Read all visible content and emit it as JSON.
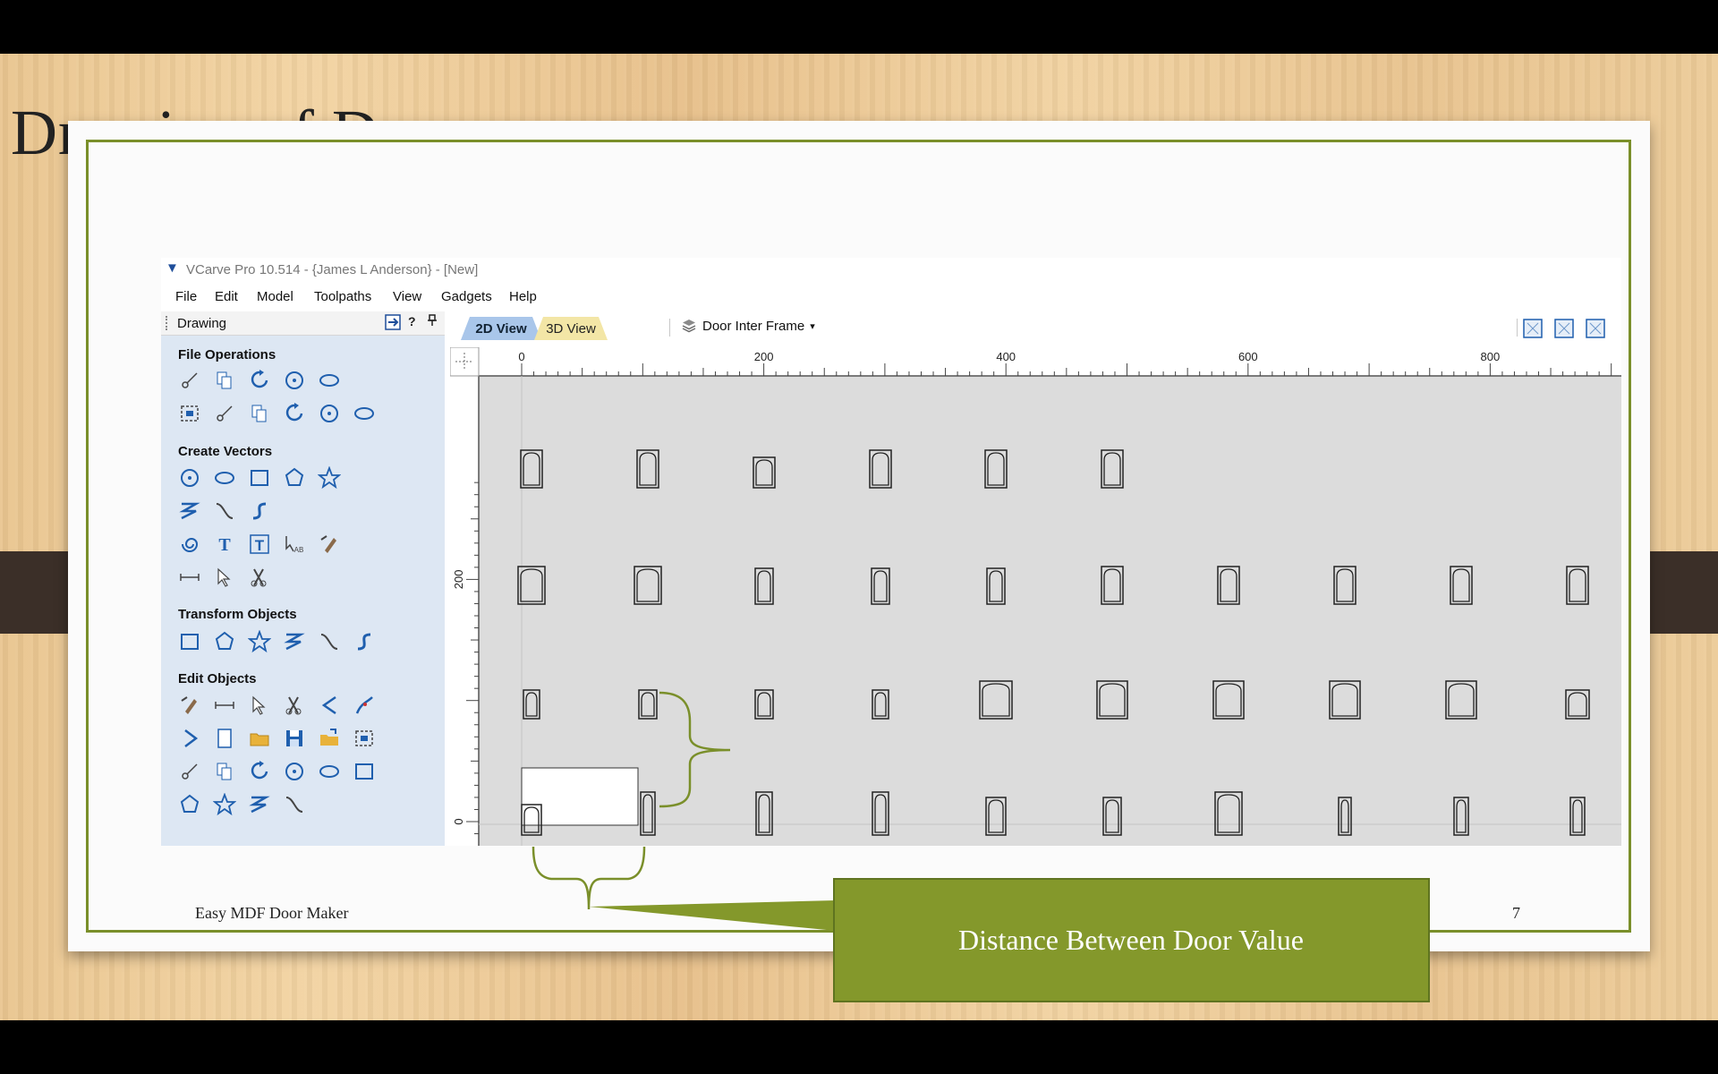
{
  "slide": {
    "title": "Drawing of Doors",
    "footer_left": "Easy MDF Door Maker",
    "page_number": "7",
    "callout_text": "Distance Between Door Value",
    "colors": {
      "frame": "#7a8f2a",
      "callout": "#84982b"
    }
  },
  "app": {
    "window_title": "VCarve Pro 10.514 - {James L Anderson} - [New]",
    "menu": [
      "File",
      "Edit",
      "Model",
      "Toolpaths",
      "View",
      "Gadgets",
      "Help"
    ],
    "panel": {
      "title": "Drawing",
      "buttons": {
        "help": "?",
        "pin": "⌂"
      },
      "sections": {
        "file_operations": "File Operations",
        "create_vectors": "Create Vectors",
        "transform_objects": "Transform Objects",
        "edit_objects": "Edit Objects"
      }
    },
    "tabs": {
      "view_2d": "2D View",
      "view_3d": "3D View"
    },
    "layer": {
      "name": "Door Inter Frame",
      "arrow": "▾"
    },
    "ruler": {
      "top_labels": [
        "0",
        "200",
        "400",
        "600",
        "800"
      ],
      "left_labels": [
        "200",
        "0"
      ]
    }
  },
  "icons": {
    "file_operations": [
      "new-file-icon",
      "open-folder-icon",
      "save-icon",
      "open-project-icon",
      "import-icon",
      "select-all-icon",
      "cut-icon",
      "copy-icon",
      "paste-icon",
      "undo-icon",
      "redo-icon"
    ],
    "create_vectors": [
      "circle-icon",
      "ellipse-icon",
      "rectangle-icon",
      "polygon-icon",
      "star-icon",
      "polyline-icon",
      "curve-icon",
      "spline-icon",
      "spiral-icon",
      "text-icon",
      "text-frame-icon",
      "text-on-curve-icon",
      "auto-layout-text-icon",
      "text-style-icon",
      "bitmap-trace-icon",
      "dimension-icon"
    ],
    "transform_objects": [
      "move-icon",
      "scale-icon",
      "align-icon",
      "mirror-icon",
      "distort-icon",
      "center-icon"
    ],
    "edit_objects": [
      "select-icon",
      "node-edit-icon",
      "transform-select-icon",
      "group-icon",
      "ungroup-icon",
      "measure-icon",
      "weld-icon",
      "subtract-icon",
      "intersect-icon",
      "trim-icon",
      "scissors-icon",
      "fillet-icon",
      "chamfer-icon",
      "angle-icon",
      "smooth-icon",
      "offset-icon",
      "image-icon",
      "crop-icon",
      "join-icon",
      "close-icon",
      "extend-icon",
      "arc-icon"
    ],
    "view_toolbar": [
      "zoom-extents-icon",
      "layout-icon",
      "grid-icon",
      "pan-icon",
      "zoom-icon",
      "zoom-in-icon",
      "zoom-out-icon",
      "snap-icon"
    ]
  },
  "doors": [
    {
      "row": "top",
      "positions": [
        0,
        1,
        2,
        3,
        4,
        5
      ]
    },
    {
      "row": "second",
      "positions": [
        0,
        1,
        2,
        3,
        4,
        5,
        6,
        7,
        8,
        9
      ]
    },
    {
      "row": "third",
      "positions": [
        0,
        1,
        2,
        3,
        4,
        5,
        6,
        7,
        8,
        9
      ]
    },
    {
      "row": "bottom",
      "positions": [
        0,
        1,
        2,
        3,
        4,
        5,
        6,
        7,
        8,
        9
      ]
    }
  ]
}
